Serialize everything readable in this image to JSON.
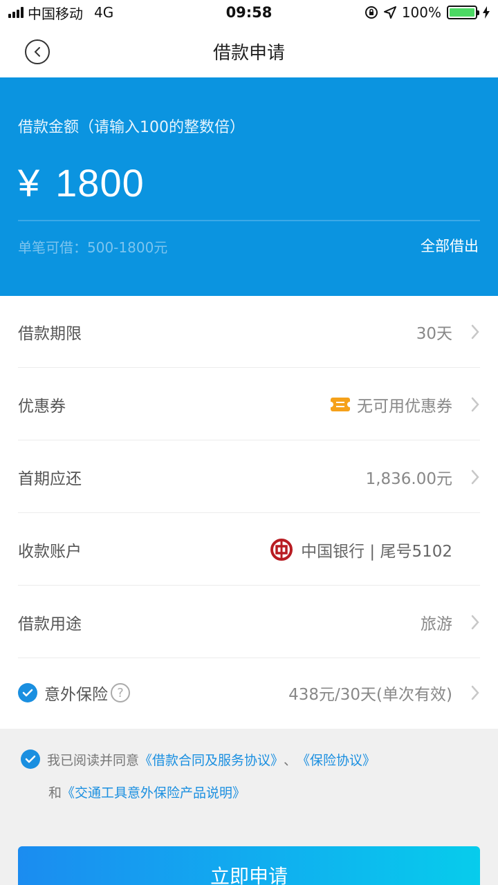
{
  "status_bar": {
    "carrier": "中国移动",
    "network": "4G",
    "time": "09:58",
    "battery": "100%",
    "battery_level": 1.0
  },
  "nav": {
    "title": "借款申请",
    "back_icon": "back-circle-icon"
  },
  "hero": {
    "label": "借款金额（请输入100的整数倍）",
    "currency": "¥",
    "amount": "1800",
    "range": "单笔可借：500-1800元",
    "borrow_all": "全部借出",
    "bg_color": "#0b94e0"
  },
  "rows": [
    {
      "label": "借款期限",
      "value": "30天"
    },
    {
      "label": "优惠券",
      "value": "无可用优惠券"
    },
    {
      "label": "首期应还",
      "value": "1,836.00元"
    },
    {
      "label": "收款账户",
      "value": "中国银行 | 尾号5102"
    },
    {
      "label": "借款用途",
      "value": "旅游"
    },
    {
      "label": "意外保险",
      "value": "438元/30天(单次有效)",
      "checked": true,
      "help": "?"
    }
  ],
  "agreement": {
    "checked": true,
    "prefix": "我已阅读并同意",
    "link1": "《借款合同及服务协议》",
    "sep": "、",
    "link2": "《保险协议》",
    "and": "和",
    "link3": "《交通工具意外保险产品说明》"
  },
  "submit": {
    "label": "立即申请"
  },
  "colors": {
    "accent": "#1a8fe0",
    "coupon": "#f5a11a",
    "boc_red": "#b81c22"
  }
}
